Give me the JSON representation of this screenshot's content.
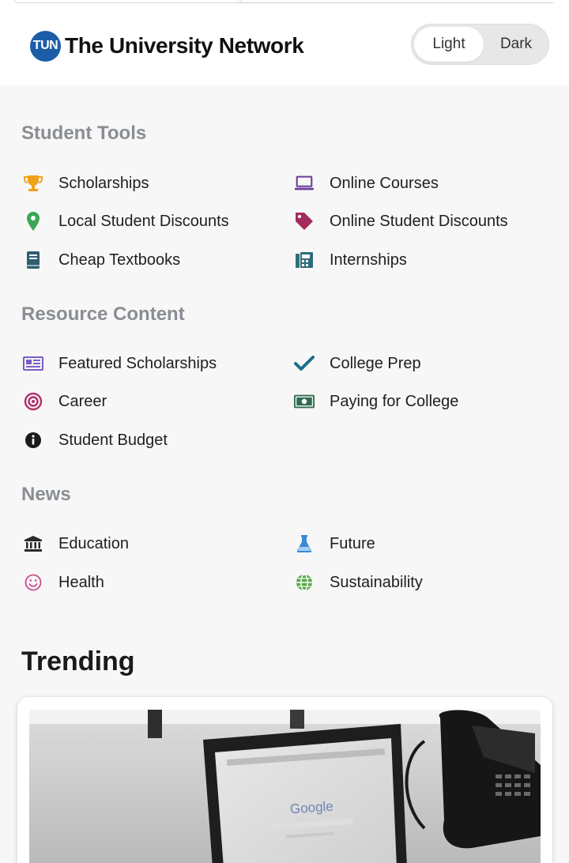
{
  "header": {
    "logo_badge": "TUN",
    "logo_text": "The University Network",
    "theme": {
      "light_label": "Light",
      "dark_label": "Dark",
      "selected": "Light"
    }
  },
  "sections": [
    {
      "title": "Student Tools",
      "items": [
        {
          "label": "Scholarships",
          "icon": "trophy-icon",
          "color": "#f0a21a"
        },
        {
          "label": "Online Courses",
          "icon": "laptop-icon",
          "color": "#6a3d9a"
        },
        {
          "label": "Local Student Discounts",
          "icon": "map-pin-icon",
          "color": "#3aa655"
        },
        {
          "label": "Online Student Discounts",
          "icon": "tag-icon",
          "color": "#a32c5e"
        },
        {
          "label": "Cheap Textbooks",
          "icon": "book-icon",
          "color": "#2e5d6f"
        },
        {
          "label": "Internships",
          "icon": "fax-icon",
          "color": "#2e6d7a"
        }
      ]
    },
    {
      "title": "Resource Content",
      "items": [
        {
          "label": "Featured Scholarships",
          "icon": "newspaper-icon",
          "color": "#7a5cc7"
        },
        {
          "label": "College Prep",
          "icon": "checkmark-icon",
          "color": "#1d6f8a"
        },
        {
          "label": "Career",
          "icon": "target-icon",
          "color": "#b0306a"
        },
        {
          "label": "Paying for College",
          "icon": "money-bill-icon",
          "color": "#2f6b50"
        },
        {
          "label": "Student Budget",
          "icon": "info-circle-icon",
          "color": "#1a1a1a"
        }
      ]
    },
    {
      "title": "News",
      "items": [
        {
          "label": "Education",
          "icon": "university-icon",
          "color": "#2a2a2a"
        },
        {
          "label": "Future",
          "icon": "flask-icon",
          "color": "#3a8ad6"
        },
        {
          "label": "Health",
          "icon": "smile-icon",
          "color": "#c94f8a"
        },
        {
          "label": "Sustainability",
          "icon": "globe-icon",
          "color": "#5aa84a"
        }
      ]
    }
  ],
  "trending": {
    "title": "Trending",
    "image_alt_text": "Google"
  }
}
